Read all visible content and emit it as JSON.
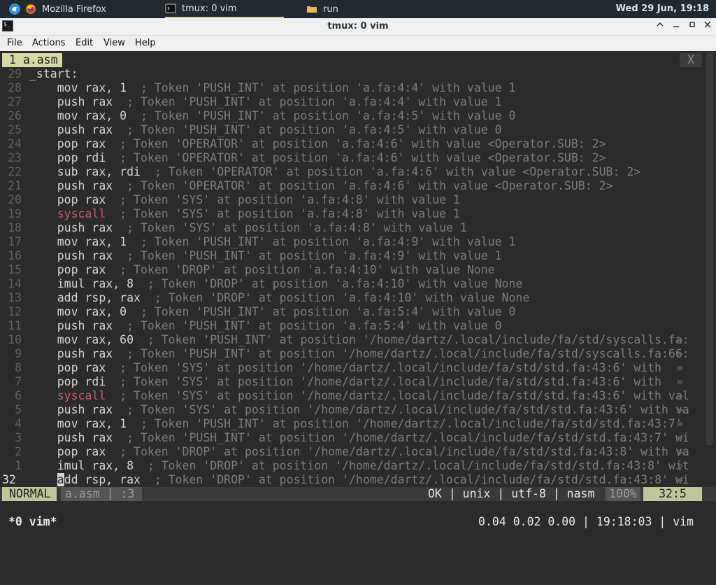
{
  "panel": {
    "tasks": [
      {
        "label": "Mozilla Firefox",
        "icon": "firefox-icon"
      },
      {
        "label": "tmux: 0 vim",
        "icon": "terminal-icon"
      },
      {
        "label": "run",
        "icon": "folder-icon"
      }
    ],
    "clock": "Wed 29 Jun, 19:18"
  },
  "window": {
    "title": "tmux: 0 vim",
    "buttons": {
      "minimize": "⌃",
      "restore": "–",
      "maximize": "▫",
      "close": "✕"
    }
  },
  "menubar": [
    "File",
    "Actions",
    "Edit",
    "View",
    "Help"
  ],
  "vim": {
    "tab_label": "1 a.asm",
    "tab_close": "X",
    "lines": [
      {
        "num": "29",
        "code": "_start:",
        "comment": ""
      },
      {
        "num": "28",
        "code": "    mov rax, 1",
        "comment": "  ; Token 'PUSH_INT' at position 'a.fa:4:4' with value 1"
      },
      {
        "num": "27",
        "code": "    push rax",
        "comment": "  ; Token 'PUSH_INT' at position 'a.fa:4:4' with value 1"
      },
      {
        "num": "26",
        "code": "    mov rax, 0",
        "comment": "  ; Token 'PUSH_INT' at position 'a.fa:4:5' with value 0"
      },
      {
        "num": "25",
        "code": "    push rax",
        "comment": "  ; Token 'PUSH_INT' at position 'a.fa:4:5' with value 0"
      },
      {
        "num": "24",
        "code": "    pop rax",
        "comment": "  ; Token 'OPERATOR' at position 'a.fa:4:6' with value <Operator.SUB: 2>"
      },
      {
        "num": "23",
        "code": "    pop rdi",
        "comment": "  ; Token 'OPERATOR' at position 'a.fa:4:6' with value <Operator.SUB: 2>"
      },
      {
        "num": "22",
        "code": "    sub rax, rdi",
        "comment": "  ; Token 'OPERATOR' at position 'a.fa:4:6' with value <Operator.SUB: 2>"
      },
      {
        "num": "21",
        "code": "    push rax",
        "comment": "  ; Token 'OPERATOR' at position 'a.fa:4:6' with value <Operator.SUB: 2>"
      },
      {
        "num": "20",
        "code": "    pop rax",
        "comment": "  ; Token 'SYS' at position 'a.fa:4:8' with value 1"
      },
      {
        "num": "19",
        "code": "    syscall",
        "comment": "  ; Token 'SYS' at position 'a.fa:4:8' with value 1",
        "sys": true
      },
      {
        "num": "18",
        "code": "    push rax",
        "comment": "  ; Token 'SYS' at position 'a.fa:4:8' with value 1"
      },
      {
        "num": "17",
        "code": "    mov rax, 1",
        "comment": "  ; Token 'PUSH_INT' at position 'a.fa:4:9' with value 1"
      },
      {
        "num": "16",
        "code": "    push rax",
        "comment": "  ; Token 'PUSH_INT' at position 'a.fa:4:9' with value 1"
      },
      {
        "num": "15",
        "code": "    pop rax",
        "comment": "  ; Token 'DROP' at position 'a.fa:4:10' with value None"
      },
      {
        "num": "14",
        "code": "    imul rax, 8",
        "comment": "  ; Token 'DROP' at position 'a.fa:4:10' with value None"
      },
      {
        "num": "13",
        "code": "    add rsp, rax",
        "comment": "  ; Token 'DROP' at position 'a.fa:4:10' with value None"
      },
      {
        "num": "12",
        "code": "    mov rax, 0",
        "comment": "  ; Token 'PUSH_INT' at position 'a.fa:5:4' with value 0"
      },
      {
        "num": "11",
        "code": "    push rax",
        "comment": "  ; Token 'PUSH_INT' at position 'a.fa:5:4' with value 0"
      },
      {
        "num": "10",
        "code": "    mov rax, 60",
        "comment": "  ; Token 'PUSH_INT' at position '/home/dartz/.local/include/fa/std/syscalls.fa:",
        "trunc": true
      },
      {
        "num": "9",
        "code": "    push rax",
        "comment": "  ; Token 'PUSH_INT' at position '/home/dartz/.local/include/fa/std/syscalls.fa:66:",
        "trunc": true
      },
      {
        "num": "8",
        "code": "    pop rax",
        "comment": "  ; Token 'SYS' at position '/home/dartz/.local/include/fa/std/std.fa:43:6' with",
        "trunc": true
      },
      {
        "num": "7",
        "code": "    pop rdi",
        "comment": "  ; Token 'SYS' at position '/home/dartz/.local/include/fa/std/std.fa:43:6' with",
        "trunc": true
      },
      {
        "num": "6",
        "code": "    syscall",
        "comment": "  ; Token 'SYS' at position '/home/dartz/.local/include/fa/std/std.fa:43:6' with val",
        "sys": true,
        "trunc": true
      },
      {
        "num": "5",
        "code": "    push rax",
        "comment": "  ; Token 'SYS' at position '/home/dartz/.local/include/fa/std/std.fa:43:6' with va",
        "trunc": true
      },
      {
        "num": "4",
        "code": "    mov rax, 1",
        "comment": "  ; Token 'PUSH_INT' at position '/home/dartz/.local/include/fa/std/std.fa:43:7' ",
        "trunc": true
      },
      {
        "num": "3",
        "code": "    push rax",
        "comment": "  ; Token 'PUSH_INT' at position '/home/dartz/.local/include/fa/std/std.fa:43:7' wi",
        "trunc": true
      },
      {
        "num": "2",
        "code": "    pop rax",
        "comment": "  ; Token 'DROP' at position '/home/dartz/.local/include/fa/std/std.fa:43:8' with va",
        "trunc": true
      },
      {
        "num": "1",
        "code": "    imul rax, 8",
        "comment": "  ; Token 'DROP' at position '/home/dartz/.local/include/fa/std/std.fa:43:8' wit",
        "trunc": true
      },
      {
        "num": "32",
        "code": "    add rsp, rax",
        "comment": "  ; Token 'DROP' at position '/home/dartz/.local/include/fa/std/std.fa:43:8' wi",
        "trunc": true,
        "current": true
      }
    ],
    "trunc_marker": "»",
    "status": {
      "mode": "NORMAL",
      "file": "a.asm | :3",
      "right": "OK | unix | utf-8 | nasm",
      "percent": "100%",
      "position": "32:5"
    }
  },
  "tmux": {
    "window": "*0 vim*",
    "right": "0.04 0.02 0.00 | 19:18:03 | vim"
  }
}
